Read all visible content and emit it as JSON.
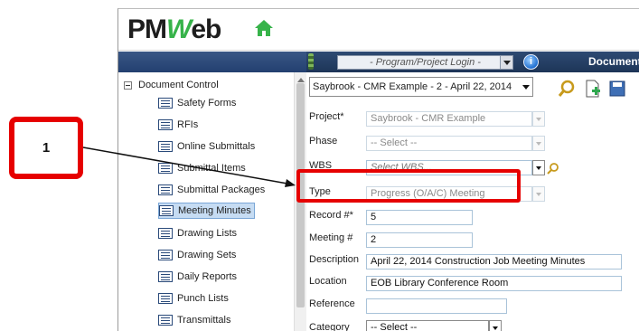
{
  "app": {
    "logo_text": "PMWeb"
  },
  "toolbar": {
    "login_placeholder": "- Program/Project Login -",
    "info_symbol": "i",
    "section_label": "Document"
  },
  "sidebar": {
    "root_label": "Document Control",
    "items": [
      {
        "label": "Safety Forms"
      },
      {
        "label": "RFIs"
      },
      {
        "label": "Online Submittals"
      },
      {
        "label": "Submittal Items"
      },
      {
        "label": "Submittal Packages"
      },
      {
        "label": "Meeting Minutes",
        "selected": true
      },
      {
        "label": "Drawing Lists"
      },
      {
        "label": "Drawing Sets"
      },
      {
        "label": "Daily Reports"
      },
      {
        "label": "Punch Lists"
      },
      {
        "label": "Transmittals"
      }
    ]
  },
  "main": {
    "record_select": "Saybrook - CMR Example - 2 - April 22, 2014",
    "fields": {
      "project": {
        "label": "Project*",
        "value": "Saybrook - CMR Example"
      },
      "phase": {
        "label": "Phase",
        "value": "-- Select --"
      },
      "wbs": {
        "label": "WBS",
        "value": "Select WBS..."
      },
      "type": {
        "label": "Type",
        "value": "Progress (O/A/C) Meeting"
      },
      "record_no": {
        "label": "Record #*",
        "value": "5"
      },
      "meeting_no": {
        "label": "Meeting #",
        "value": "2"
      },
      "description": {
        "label": "Description",
        "value": "April 22, 2014 Construction Job Meeting Minutes"
      },
      "location": {
        "label": "Location",
        "value": "EOB Library Conference Room"
      },
      "reference": {
        "label": "Reference",
        "value": ""
      },
      "category": {
        "label": "Category",
        "value": "-- Select --"
      }
    }
  },
  "annotation": {
    "callout_number": "1"
  },
  "colors": {
    "annotation_red": "#e60000",
    "toolbar_navy": "#1d3557",
    "logo_green": "#37b34a",
    "selection_blue": "#c6dcf3"
  }
}
